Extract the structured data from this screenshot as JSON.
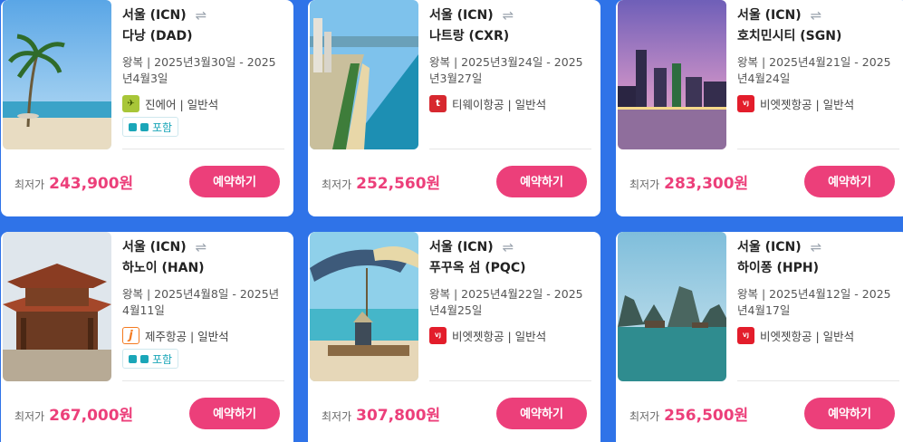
{
  "cards": [
    {
      "from": "서울 (ICN)",
      "to": "다낭 (DAD)",
      "dates": "왕복 | 2025년3월30일 - 2025년4월3일",
      "airline": "진에어 | 일반석",
      "airline_logo": "jin",
      "baggage": "포함",
      "price_label": "최저가",
      "price": "243,900원",
      "book_label": "예약하기",
      "image": "beach-palm"
    },
    {
      "from": "서울 (ICN)",
      "to": "나트랑 (CXR)",
      "dates": "왕복 | 2025년3월24일 - 2025년3월27일",
      "airline": "티웨이항공 | 일반석",
      "airline_logo": "tw",
      "baggage": null,
      "price_label": "최저가",
      "price": "252,560원",
      "book_label": "예약하기",
      "image": "coastal-city"
    },
    {
      "from": "서울 (ICN)",
      "to": "호치민시티 (SGN)",
      "dates": "왕복 | 2025년4월21일 - 2025년4월24일",
      "airline": "비엣젯항공 | 일반석",
      "airline_logo": "vj",
      "baggage": null,
      "price_label": "최저가",
      "price": "283,300원",
      "book_label": "예약하기",
      "image": "city-dusk"
    },
    {
      "from": "서울 (ICN)",
      "to": "하노이 (HAN)",
      "dates": "왕복 | 2025년4월8일 - 2025년4월11일",
      "airline": "제주항공 | 일반석",
      "airline_logo": "jeju",
      "baggage": "포함",
      "price_label": "최저가",
      "price": "267,000원",
      "book_label": "예약하기",
      "image": "temple"
    },
    {
      "from": "서울 (ICN)",
      "to": "푸꾸옥 섬 (PQC)",
      "dates": "왕복 | 2025년4월22일 - 2025년4월25일",
      "airline": "비엣젯항공 | 일반석",
      "airline_logo": "vj",
      "baggage": null,
      "price_label": "최저가",
      "price": "307,800원",
      "book_label": "예약하기",
      "image": "umbrella-beach"
    },
    {
      "from": "서울 (ICN)",
      "to": "하이퐁 (HPH)",
      "dates": "왕복 | 2025년4월12일 - 2025년4월17일",
      "airline": "비엣젯항공 | 일반석",
      "airline_logo": "vj",
      "baggage": null,
      "price_label": "최저가",
      "price": "256,500원",
      "book_label": "예약하기",
      "image": "bay-karst"
    }
  ],
  "colors": {
    "accent": "#ec3f7a",
    "background": "#2f73e8",
    "baggage": "#1aa6b8"
  }
}
